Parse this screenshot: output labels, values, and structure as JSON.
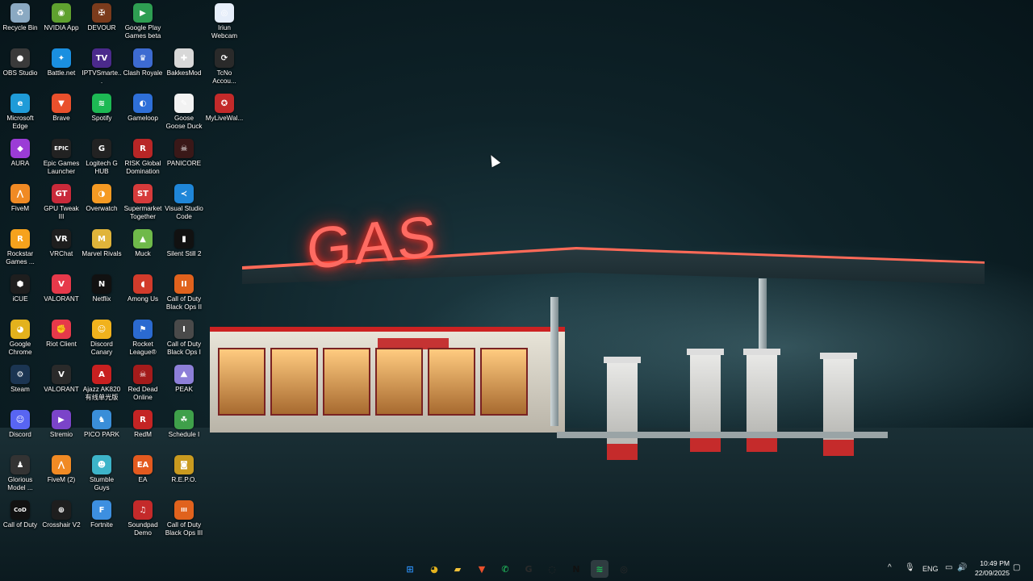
{
  "wallpaper": {
    "sign_text": "GAS"
  },
  "desktop_icons": [
    {
      "label": "Recycle Bin",
      "color": "#8aa9c2",
      "glyph": "♻",
      "col": 0,
      "row": 0
    },
    {
      "label": "NVIDIA App",
      "color": "#5fa12f",
      "glyph": "◉",
      "col": 1,
      "row": 0
    },
    {
      "label": "DEVOUR",
      "color": "#7b3b1c",
      "glyph": "✠",
      "col": 2,
      "row": 0
    },
    {
      "label": "Google Play Games beta",
      "color": "#2e9e52",
      "glyph": "▶",
      "col": 3,
      "row": 0
    },
    {
      "label": "Iriun Webcam",
      "color": "#e6eefa",
      "glyph": "◎",
      "col": 5,
      "row": 0
    },
    {
      "label": "OBS Studio",
      "color": "#3a3a3a",
      "glyph": "●",
      "col": 0,
      "row": 1
    },
    {
      "label": "Battle.net",
      "color": "#1a8fe0",
      "glyph": "✦",
      "col": 1,
      "row": 1
    },
    {
      "label": "IPTVSmarte...",
      "color": "#4b2a8c",
      "glyph": "TV",
      "col": 2,
      "row": 1
    },
    {
      "label": "Clash Royale",
      "color": "#3d6bd1",
      "glyph": "♛",
      "col": 3,
      "row": 1
    },
    {
      "label": "BakkesMod",
      "color": "#d8d8d8",
      "glyph": "✚",
      "col": 4,
      "row": 1
    },
    {
      "label": "TcNo Accou...",
      "color": "#2a2a2a",
      "glyph": "⟳",
      "col": 5,
      "row": 1
    },
    {
      "label": "Microsoft Edge",
      "color": "#1f9bd8",
      "glyph": "e",
      "col": 0,
      "row": 2
    },
    {
      "label": "Brave",
      "color": "#e9502c",
      "glyph": "▼",
      "col": 1,
      "row": 2
    },
    {
      "label": "Spotify",
      "color": "#1db954",
      "glyph": "≋",
      "col": 2,
      "row": 2
    },
    {
      "label": "Gameloop",
      "color": "#2e6fd8",
      "glyph": "◐",
      "col": 3,
      "row": 2
    },
    {
      "label": "Goose Goose Duck",
      "color": "#f2f2f2",
      "glyph": "✎",
      "col": 4,
      "row": 2
    },
    {
      "label": "MyLiveWal...",
      "color": "#c32a2a",
      "glyph": "✪",
      "col": 5,
      "row": 2
    },
    {
      "label": "AURA",
      "color": "#9b3cd6",
      "glyph": "◆",
      "col": 0,
      "row": 3
    },
    {
      "label": "Epic Games Launcher",
      "color": "#222222",
      "glyph": "EPIC",
      "col": 1,
      "row": 3
    },
    {
      "label": "Logitech G HUB",
      "color": "#222222",
      "glyph": "G",
      "col": 2,
      "row": 3
    },
    {
      "label": "RISK Global Domination",
      "color": "#b82626",
      "glyph": "R",
      "col": 3,
      "row": 3
    },
    {
      "label": "PANICORE",
      "color": "#3a1818",
      "glyph": "☠",
      "col": 4,
      "row": 3
    },
    {
      "label": "FiveM",
      "color": "#f08a24",
      "glyph": "⋀",
      "col": 0,
      "row": 4
    },
    {
      "label": "GPU Tweak III",
      "color": "#c92a3a",
      "glyph": "GT",
      "col": 1,
      "row": 4
    },
    {
      "label": "Overwatch",
      "color": "#f59a23",
      "glyph": "◑",
      "col": 2,
      "row": 4
    },
    {
      "label": "Supermarket Together",
      "color": "#d63b3b",
      "glyph": "ST",
      "col": 3,
      "row": 4
    },
    {
      "label": "Visual Studio Code",
      "color": "#1f86d8",
      "glyph": "≺",
      "col": 4,
      "row": 4
    },
    {
      "label": "Rockstar Games ...",
      "color": "#f6a21d",
      "glyph": "R",
      "col": 0,
      "row": 5
    },
    {
      "label": "VRChat",
      "color": "#1e1e1e",
      "glyph": "VR",
      "col": 1,
      "row": 5
    },
    {
      "label": "Marvel Rivals",
      "color": "#e0b43a",
      "glyph": "M",
      "col": 2,
      "row": 5
    },
    {
      "label": "Muck",
      "color": "#6fb94a",
      "glyph": "▲",
      "col": 3,
      "row": 5
    },
    {
      "label": "Silent Still 2",
      "color": "#111111",
      "glyph": "▮",
      "col": 4,
      "row": 5
    },
    {
      "label": "iCUE",
      "color": "#1e1e1e",
      "glyph": "⬢",
      "col": 0,
      "row": 6
    },
    {
      "label": "VALORANT",
      "color": "#e6394a",
      "glyph": "V",
      "col": 1,
      "row": 6
    },
    {
      "label": "Netflix",
      "color": "#111111",
      "glyph": "N",
      "col": 2,
      "row": 6
    },
    {
      "label": "Among Us",
      "color": "#d23b2b",
      "glyph": "◖",
      "col": 3,
      "row": 6
    },
    {
      "label": "Call of Duty Black Ops II",
      "color": "#e0621d",
      "glyph": "II",
      "col": 4,
      "row": 6
    },
    {
      "label": "Google Chrome",
      "color": "#e3b21d",
      "glyph": "◕",
      "col": 0,
      "row": 7
    },
    {
      "label": "Riot Client",
      "color": "#e6394a",
      "glyph": "✊",
      "col": 1,
      "row": 7
    },
    {
      "label": "Discord Canary",
      "color": "#f1b21d",
      "glyph": "☺",
      "col": 2,
      "row": 7
    },
    {
      "label": "Rocket League®",
      "color": "#2b6ad0",
      "glyph": "⚑",
      "col": 3,
      "row": 7
    },
    {
      "label": "Call of Duty Black Ops I",
      "color": "#4a4a4a",
      "glyph": "I",
      "col": 4,
      "row": 7
    },
    {
      "label": "Steam",
      "color": "#1b3552",
      "glyph": "⚙",
      "col": 0,
      "row": 8
    },
    {
      "label": "VALORANT",
      "color": "#2a2a2a",
      "glyph": "V",
      "col": 1,
      "row": 8
    },
    {
      "label": "Ajazz AK820 有线单光版",
      "color": "#c82020",
      "glyph": "A",
      "col": 2,
      "row": 8
    },
    {
      "label": "Red Dead Online",
      "color": "#a31b1b",
      "glyph": "☠",
      "col": 3,
      "row": 8
    },
    {
      "label": "PEAK",
      "color": "#8d7fd8",
      "glyph": "⛰",
      "col": 4,
      "row": 8
    },
    {
      "label": "Discord",
      "color": "#5865f2",
      "glyph": "☺",
      "col": 0,
      "row": 9
    },
    {
      "label": "Stremio",
      "color": "#7b44c9",
      "glyph": "▶",
      "col": 1,
      "row": 9
    },
    {
      "label": "PICO PARK",
      "color": "#3a8ed8",
      "glyph": "♞",
      "col": 2,
      "row": 9
    },
    {
      "label": "RedM",
      "color": "#c42424",
      "glyph": "R",
      "col": 3,
      "row": 9
    },
    {
      "label": "Schedule I",
      "color": "#3fa04a",
      "glyph": "☘",
      "col": 4,
      "row": 9
    },
    {
      "label": "Glorious Model ...",
      "color": "#333333",
      "glyph": "♟",
      "col": 0,
      "row": 10
    },
    {
      "label": "FiveM (2)",
      "color": "#f08a24",
      "glyph": "⋀",
      "col": 1,
      "row": 10
    },
    {
      "label": "Stumble Guys",
      "color": "#3db4c9",
      "glyph": "☻",
      "col": 2,
      "row": 10
    },
    {
      "label": "EA",
      "color": "#e35a1f",
      "glyph": "EA",
      "col": 3,
      "row": 10
    },
    {
      "label": "R.E.P.O.",
      "color": "#c99a1f",
      "glyph": "◙",
      "col": 4,
      "row": 10
    },
    {
      "label": "Call of Duty",
      "color": "#111111",
      "glyph": "CoD",
      "col": 0,
      "row": 11
    },
    {
      "label": "Crosshair V2",
      "color": "#1e1e1e",
      "glyph": "⊕",
      "col": 1,
      "row": 11
    },
    {
      "label": "Fortnite",
      "color": "#3d8fe0",
      "glyph": "F",
      "col": 2,
      "row": 11
    },
    {
      "label": "Soundpad Demo",
      "color": "#c42a2a",
      "glyph": "♫",
      "col": 3,
      "row": 11
    },
    {
      "label": "Call of Duty Black Ops III",
      "color": "#e0621d",
      "glyph": "III",
      "col": 4,
      "row": 11
    }
  ],
  "taskbar": {
    "apps": [
      {
        "name": "start-button",
        "glyph": "⊞",
        "color": "#2b8cf0"
      },
      {
        "name": "taskbar-chrome",
        "glyph": "◕",
        "color": "#e3b21d"
      },
      {
        "name": "taskbar-file-explorer",
        "glyph": "▰",
        "color": "#f2c23a"
      },
      {
        "name": "taskbar-brave",
        "glyph": "▼",
        "color": "#e9502c"
      },
      {
        "name": "taskbar-whatsapp",
        "glyph": "✆",
        "color": "#25d366"
      },
      {
        "name": "taskbar-logitech",
        "glyph": "G",
        "color": "#2a2a2a"
      },
      {
        "name": "taskbar-app-ring",
        "glyph": "◌",
        "color": "#2a2a2a"
      },
      {
        "name": "taskbar-netflix",
        "glyph": "N",
        "color": "#111111"
      },
      {
        "name": "taskbar-spotify",
        "glyph": "≋",
        "color": "#1db954"
      },
      {
        "name": "taskbar-steelseries",
        "glyph": "◎",
        "color": "#2a2a2a"
      }
    ],
    "tray": {
      "chevron": "^",
      "mic": "🎙",
      "language": "ENG",
      "network": "▭",
      "volume": "🔊",
      "notification": "▢"
    },
    "clock": {
      "time": "10:49 PM",
      "date": "22/09/2025"
    }
  }
}
